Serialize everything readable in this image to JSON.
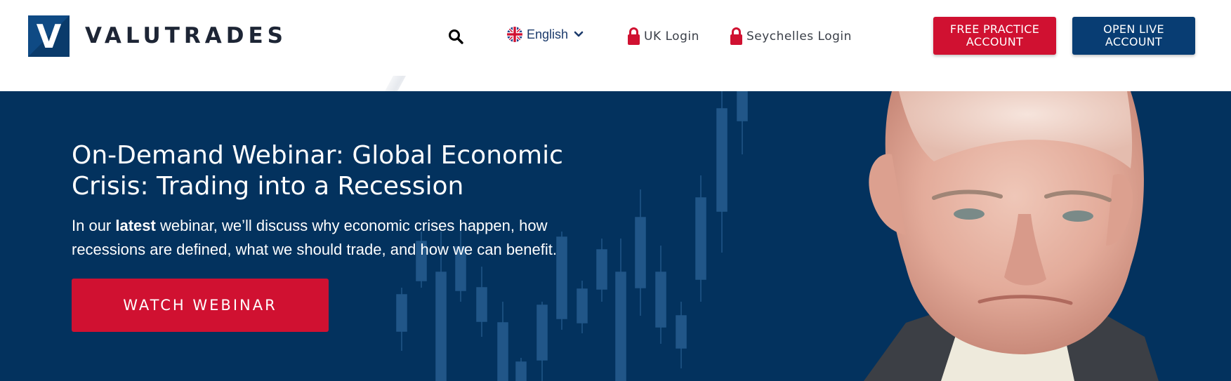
{
  "brand": {
    "name": "VALUTRADES",
    "logo_letter": "V"
  },
  "nav": {
    "search_icon": "search-icon",
    "language": {
      "label": "English",
      "flag": "uk-flag-icon"
    },
    "uk_login": "UK Login",
    "seychelles_login": "Seychelles Login",
    "free_practice_account": {
      "line1": "FREE PRACTICE",
      "line2": "ACCOUNT"
    },
    "open_live_account": {
      "line1": "OPEN LIVE",
      "line2": "ACCOUNT"
    }
  },
  "hero": {
    "title_line1": "On-Demand Webinar: Global Economic",
    "title_line2": "Crisis: Trading into a Recession",
    "desc_before": "In our ",
    "desc_bold": "latest",
    "desc_after": " webinar, we’ll discuss why economic crises happen, how recessions are defined, what we should trade, and how we can benefit.",
    "cta_label": "WATCH WEBINAR"
  },
  "colors": {
    "brand_navy": "#03325e",
    "brand_red": "#d01131",
    "button_navy": "#083d73",
    "candle": "#255a8d"
  }
}
